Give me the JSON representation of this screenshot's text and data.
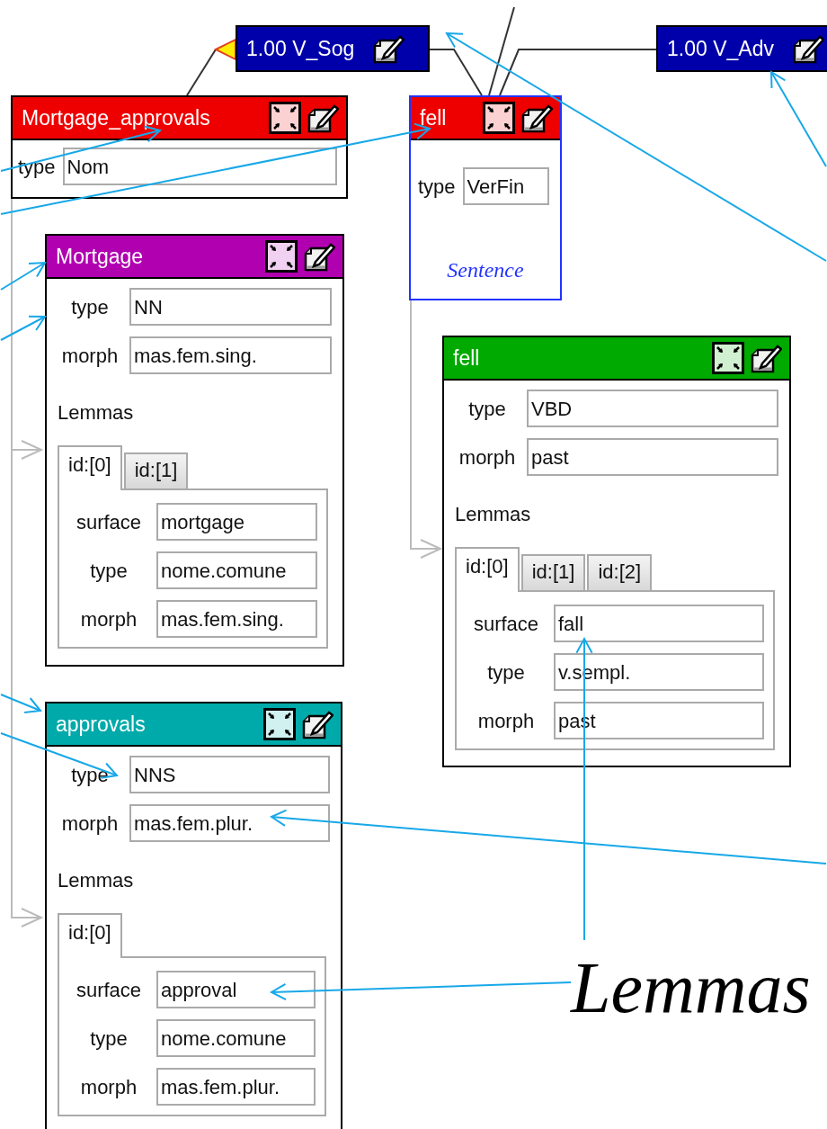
{
  "relations": [
    {
      "label": "1.00 V_Sog"
    },
    {
      "label": "1.00 V_Adv"
    }
  ],
  "nodes": [
    {
      "title": "Mortgage_approvals",
      "color": "#ee0000",
      "selected": false,
      "fields": [
        {
          "label": "type",
          "value": "Nom"
        }
      ]
    },
    {
      "title": "fell",
      "color": "#ee0000",
      "selected": true,
      "fields": [
        {
          "label": "type",
          "value": "VerFin"
        }
      ],
      "footer": "Sentence"
    },
    {
      "title": "Mortgage",
      "color": "#b000b0",
      "selected": false,
      "fields": [
        {
          "label": "type",
          "value": "NN"
        },
        {
          "label": "morph",
          "value": "mas.fem.sing."
        }
      ],
      "lemmas": {
        "heading": "Lemmas",
        "tabs": [
          {
            "label": "id:[0]",
            "selected": true
          },
          {
            "label": "id:[1]",
            "selected": false
          }
        ],
        "fields": [
          {
            "label": "surface",
            "value": "mortgage"
          },
          {
            "label": "type",
            "value": "nome.comune"
          },
          {
            "label": "morph",
            "value": "mas.fem.sing."
          }
        ]
      }
    },
    {
      "title": "fell",
      "color": "#00aa00",
      "selected": false,
      "fields": [
        {
          "label": "type",
          "value": "VBD"
        },
        {
          "label": "morph",
          "value": "past"
        }
      ],
      "lemmas": {
        "heading": "Lemmas",
        "tabs": [
          {
            "label": "id:[0]",
            "selected": true
          },
          {
            "label": "id:[1]",
            "selected": false
          },
          {
            "label": "id:[2]",
            "selected": false
          }
        ],
        "fields": [
          {
            "label": "surface",
            "value": "fall"
          },
          {
            "label": "type",
            "value": "v.sempl."
          },
          {
            "label": "morph",
            "value": "past"
          }
        ]
      }
    },
    {
      "title": "approvals",
      "color": "#00aaaa",
      "selected": false,
      "fields": [
        {
          "label": "type",
          "value": "NNS"
        },
        {
          "label": "morph",
          "value": "mas.fem.plur."
        }
      ],
      "lemmas": {
        "heading": "Lemmas",
        "tabs": [
          {
            "label": "id:[0]",
            "selected": true
          }
        ],
        "fields": [
          {
            "label": "surface",
            "value": "approval"
          },
          {
            "label": "type",
            "value": "nome.comune"
          },
          {
            "label": "morph",
            "value": "mas.fem.plur."
          }
        ]
      }
    }
  ],
  "annotation": {
    "text": "Lemmas"
  }
}
